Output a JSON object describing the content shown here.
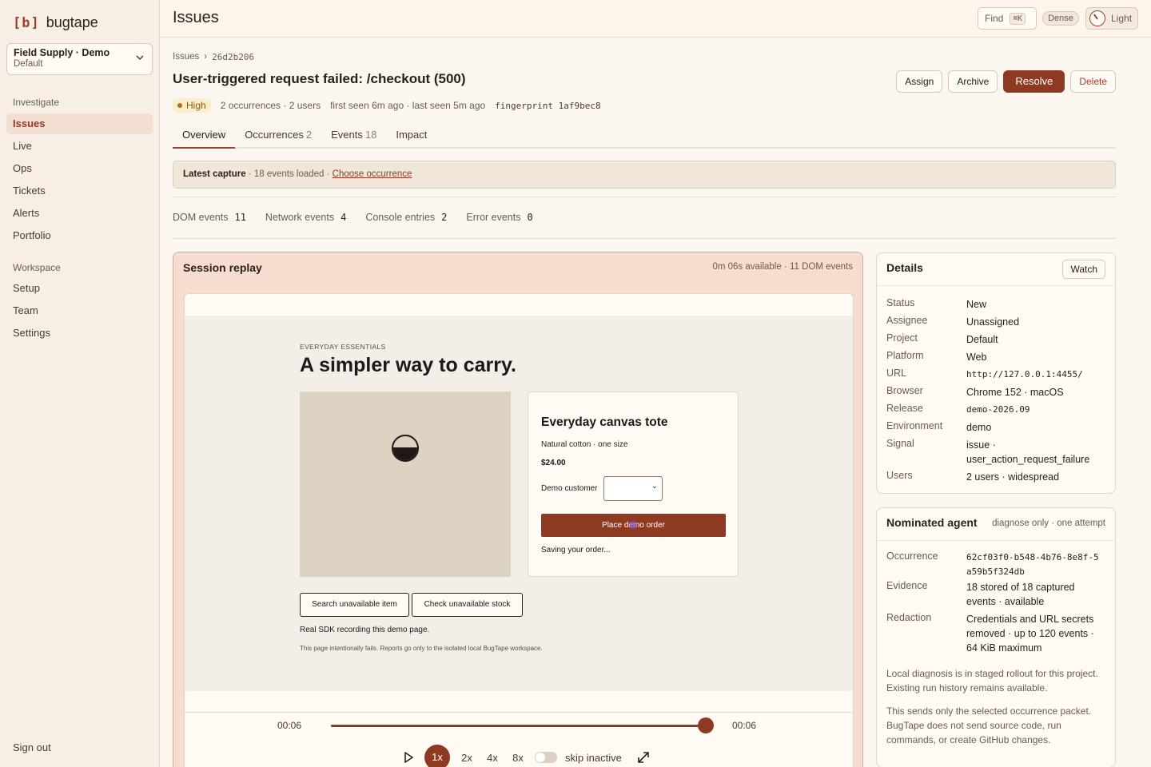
{
  "sidebar": {
    "logo_mark": "[b]",
    "logo_text": "bugtape",
    "project_name": "Field Supply · Demo",
    "project_env": "Default",
    "section_investigate": "Investigate",
    "investigate_items": [
      "Issues",
      "Live",
      "Ops",
      "Tickets",
      "Alerts",
      "Portfolio"
    ],
    "section_workspace": "Workspace",
    "workspace_items": [
      "Setup",
      "Team",
      "Settings"
    ],
    "sign_out": "Sign out"
  },
  "topbar": {
    "title": "Issues",
    "find_label": "Find",
    "find_shortcut": "⌘K",
    "dense_label": "Dense",
    "theme_label": "Light"
  },
  "issue": {
    "breadcrumb_root": "Issues",
    "breadcrumb_sep": "›",
    "breadcrumb_id": "26d2b206",
    "title": "User-triggered request failed: /checkout (500)",
    "severity": "High",
    "occurrences": "2 occurrences · 2 users",
    "seen": "first seen 6m ago · last seen 5m ago",
    "fingerprint": "fingerprint 1af9bec8",
    "actions": {
      "assign": "Assign",
      "archive": "Archive",
      "resolve": "Resolve",
      "delete": "Delete"
    }
  },
  "tabs": [
    {
      "label": "Overview",
      "count": ""
    },
    {
      "label": "Occurrences",
      "count": "2"
    },
    {
      "label": "Events",
      "count": "18"
    },
    {
      "label": "Impact",
      "count": ""
    }
  ],
  "capture": {
    "label": "Latest capture",
    "detail": " · 18 events loaded · ",
    "link": "Choose occurrence"
  },
  "stats": [
    {
      "label": "DOM events",
      "value": "11"
    },
    {
      "label": "Network events",
      "value": "4"
    },
    {
      "label": "Console entries",
      "value": "2"
    },
    {
      "label": "Error events",
      "value": "0"
    }
  ],
  "replay": {
    "title": "Session replay",
    "meta": "0m 06s available · 11 DOM events",
    "page": {
      "eyebrow": "EVERYDAY ESSENTIALS",
      "headline": "A simpler way to carry.",
      "product_title": "Everyday canvas tote",
      "product_sub": "Natural cotton · one size",
      "price": "$24.00",
      "customer_label": "Demo customer",
      "order_button": "Place demo order",
      "saving": "Saving your order...",
      "button_search": "Search unavailable item",
      "button_stock": "Check unavailable stock",
      "note": "Real SDK recording this demo page.",
      "fine": "This page intentionally fails. Reports go only to the isolated local BugTape workspace."
    },
    "player": {
      "time_current": "00:06",
      "time_total": "00:06",
      "progress": 1.0,
      "speeds": [
        "1x",
        "2x",
        "4x",
        "8x"
      ],
      "active_speed": "1x",
      "skip_label": "skip inactive"
    }
  },
  "details": {
    "title": "Details",
    "watch": "Watch",
    "rows": [
      {
        "k": "Status",
        "v": "New"
      },
      {
        "k": "Assignee",
        "v": "Unassigned"
      },
      {
        "k": "Project",
        "v": "Default"
      },
      {
        "k": "Platform",
        "v": "Web"
      },
      {
        "k": "URL",
        "v": "http://127.0.0.1:4455/"
      },
      {
        "k": "Browser",
        "v": "Chrome 152 · macOS"
      },
      {
        "k": "Release",
        "v": "demo-2026.09"
      },
      {
        "k": "Environment",
        "v": "demo"
      },
      {
        "k": "Signal",
        "v": "issue · user_action_request_failure"
      },
      {
        "k": "Users",
        "v": "2 users · widespread"
      }
    ]
  },
  "agent": {
    "title": "Nominated agent",
    "sub": "diagnose only · one attempt",
    "rows": [
      {
        "k": "Occurrence",
        "v": "62cf03f0-b548-4b76-8e8f-5a59b5f324db"
      },
      {
        "k": "Evidence",
        "v": "18 stored of 18 captured events · available"
      },
      {
        "k": "Redaction",
        "v": "Credentials and URL secrets removed · up to 120 events · 64 KiB maximum"
      }
    ],
    "note1": "Local diagnosis is in staged rollout for this project. Existing run history remains available.",
    "note2": "This sends only the selected occurrence packet. BugTape does not send source code, run commands, or create GitHub changes."
  }
}
